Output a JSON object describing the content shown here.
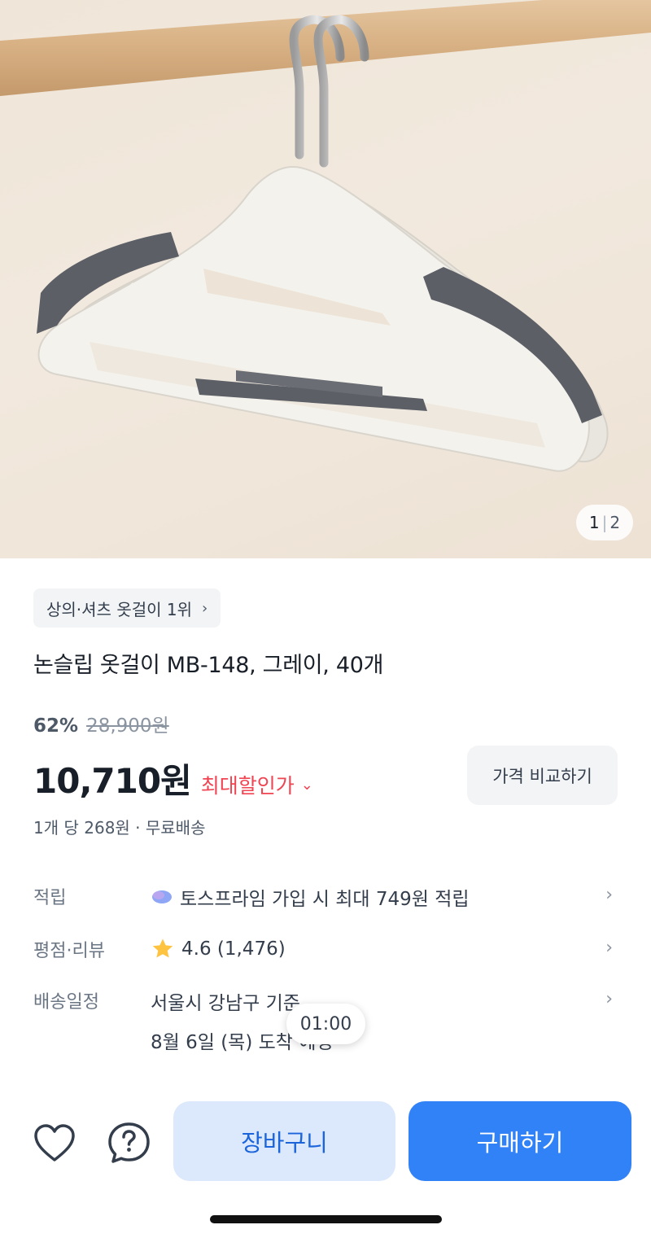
{
  "product_image": {
    "current": "1",
    "total": "2"
  },
  "rank_badge": {
    "label": "상의·셔츠 옷걸이 1위"
  },
  "product": {
    "title": "논슬립 옷걸이 MB-148, 그레이, 40개",
    "discount_rate": "62%",
    "original_price": "28,900원",
    "price": "10,710원",
    "max_discount_label": "최대할인가",
    "compare_button": "가격 비교하기",
    "unit_info": "1개 당 268원 · 무료배송"
  },
  "info_rows": {
    "points": {
      "label": "적립",
      "value": "토스프라임 가입 시 최대 749원 적립"
    },
    "rating": {
      "label": "평점·리뷰",
      "value": "4.6 (1,476)"
    },
    "shipping": {
      "label": "배송일정",
      "line1": "서울시 강남구 기준",
      "line2": "8월 6일 (목) 도착 예정"
    }
  },
  "timer": {
    "value": "01:00"
  },
  "bottom_bar": {
    "cart_label": "장바구니",
    "buy_label": "구매하기"
  },
  "colors": {
    "primary": "#3182f6",
    "cart_bg": "#dce9fc",
    "discount_red": "#f04452",
    "star": "#ffc342"
  },
  "icons": [
    "chevron-right-icon",
    "chevron-down-icon",
    "toss-prime-icon",
    "star-icon",
    "heart-icon",
    "question-icon"
  ]
}
